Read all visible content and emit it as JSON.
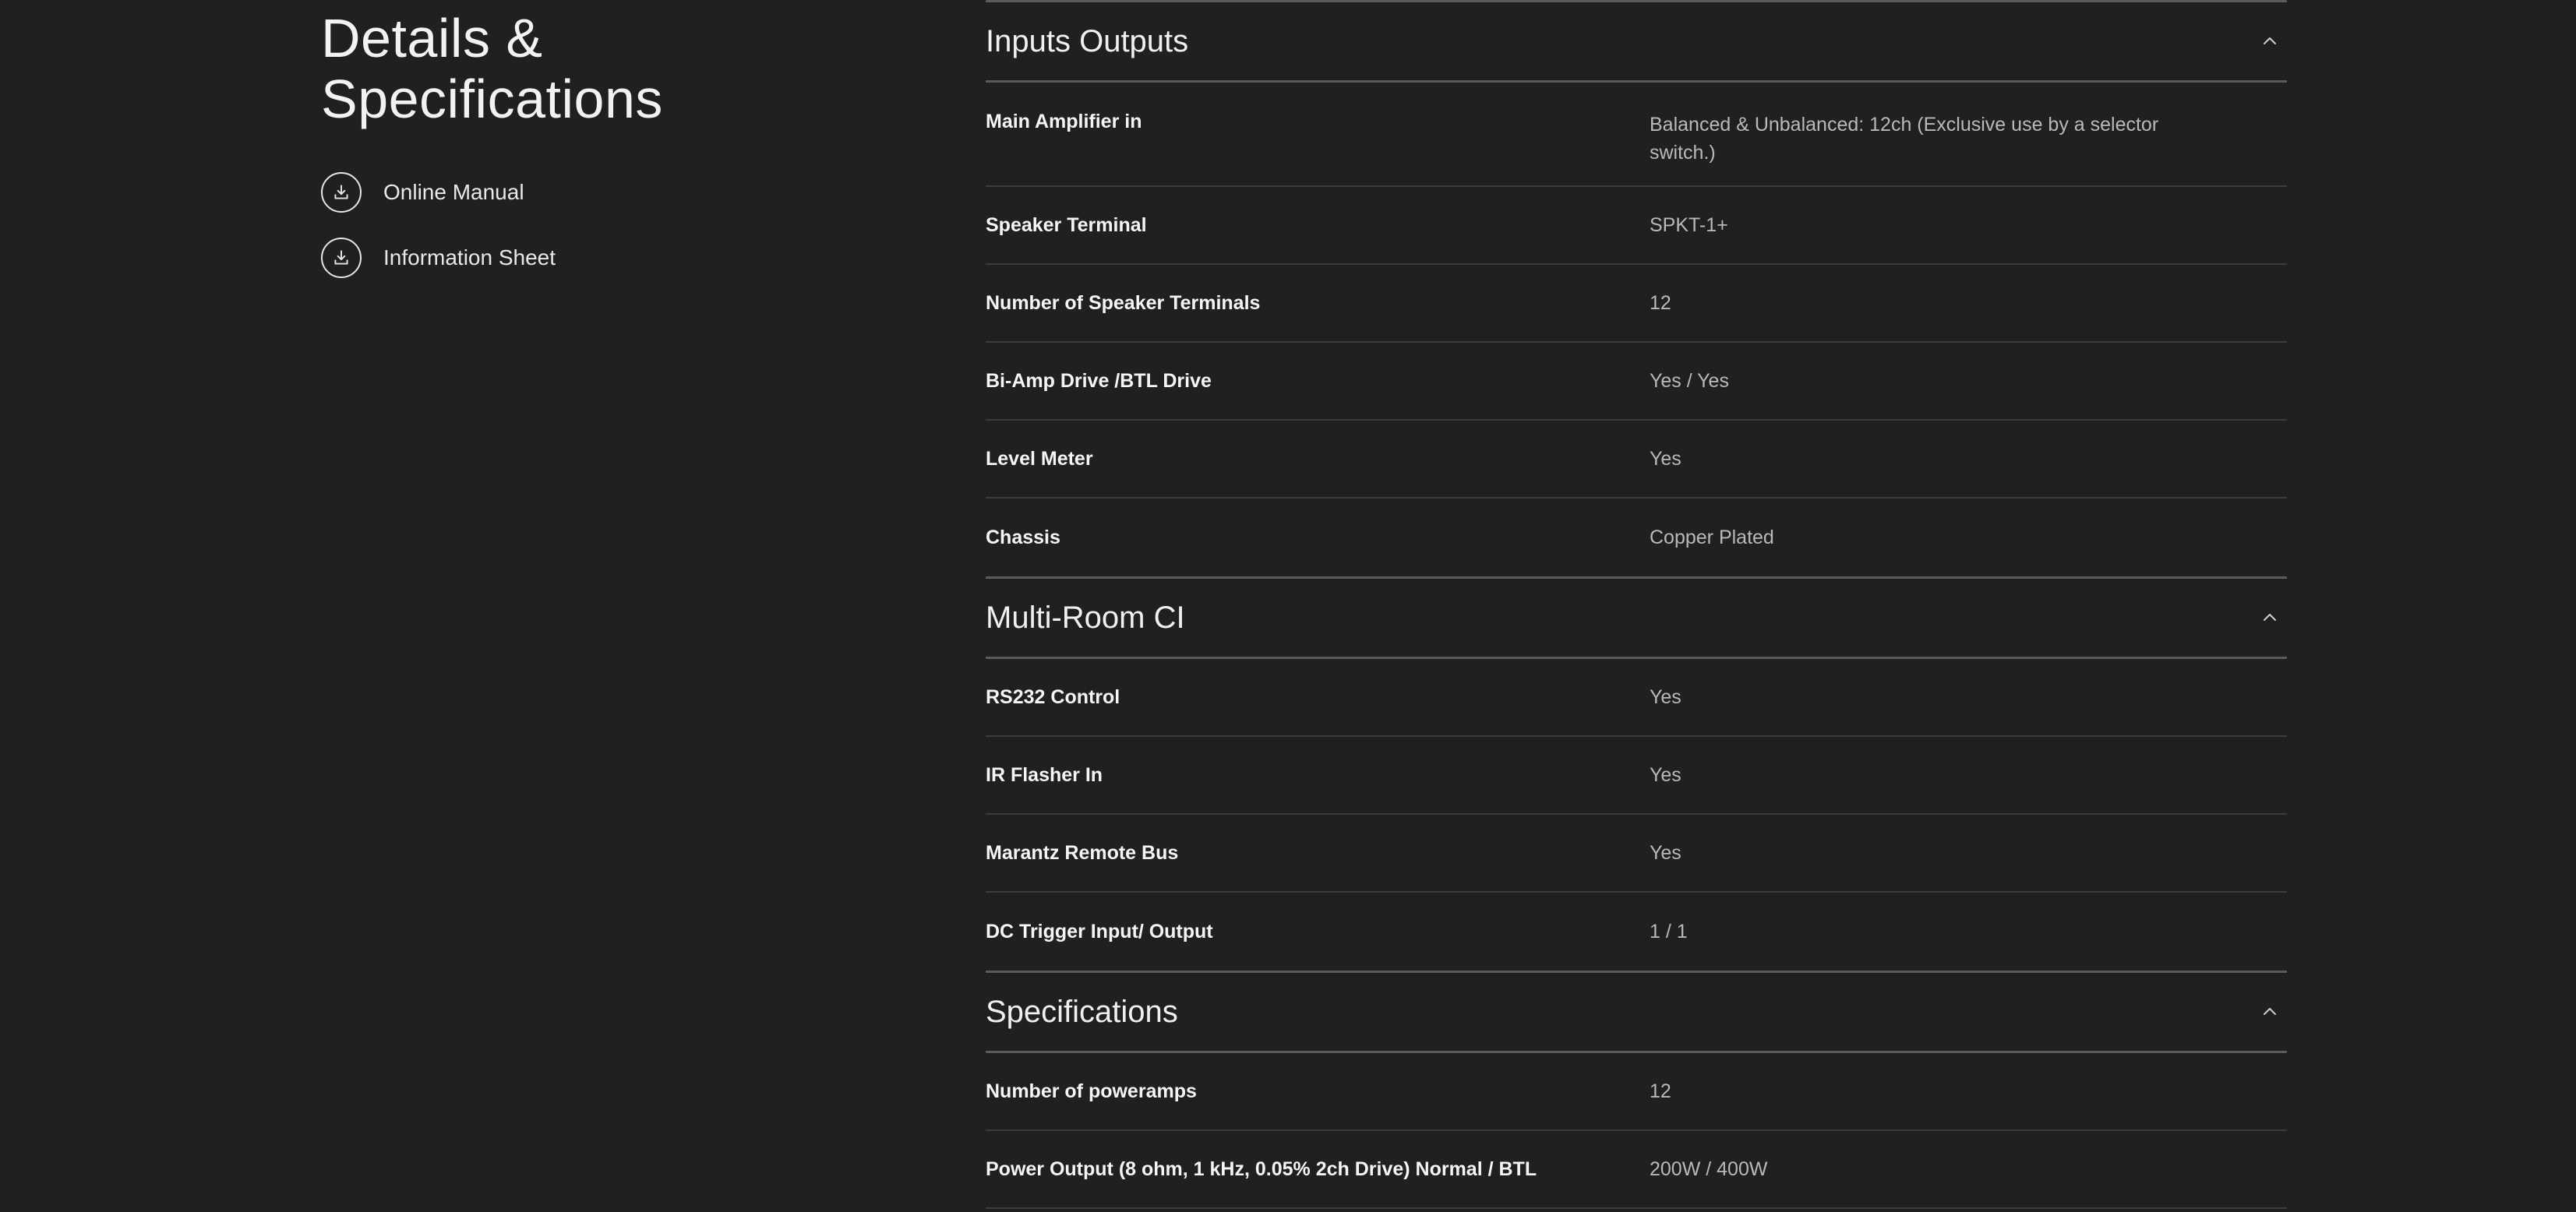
{
  "left": {
    "title_line1": "Details &",
    "title_line2": "Specifications",
    "downloads": [
      {
        "label": "Online Manual",
        "icon": "download-icon"
      },
      {
        "label": "Information Sheet",
        "icon": "download-icon"
      }
    ]
  },
  "sections": [
    {
      "title": "Inputs Outputs",
      "expanded": true,
      "rows": [
        {
          "label": "Main Amplifier in",
          "value": "Balanced & Unbalanced: 12ch (Exclusive use by a selector switch.)"
        },
        {
          "label": "Speaker Terminal",
          "value": "SPKT-1+"
        },
        {
          "label": "Number of Speaker Terminals",
          "value": "12"
        },
        {
          "label": "Bi-Amp Drive /BTL Drive",
          "value": "Yes / Yes"
        },
        {
          "label": "Level Meter",
          "value": "Yes"
        },
        {
          "label": "Chassis",
          "value": "Copper Plated"
        }
      ]
    },
    {
      "title": "Multi-Room CI",
      "expanded": true,
      "rows": [
        {
          "label": "RS232 Control",
          "value": "Yes"
        },
        {
          "label": "IR Flasher In",
          "value": "Yes"
        },
        {
          "label": "Marantz Remote Bus",
          "value": "Yes"
        },
        {
          "label": "DC Trigger Input/ Output",
          "value": "1 / 1"
        }
      ]
    },
    {
      "title": "Specifications",
      "expanded": true,
      "rows": [
        {
          "label": "Number of poweramps",
          "value": "12"
        },
        {
          "label": "Power Output (8 ohm, 1 kHz, 0.05% 2ch Drive) Normal / BTL",
          "value": "200W / 400W"
        }
      ]
    }
  ]
}
